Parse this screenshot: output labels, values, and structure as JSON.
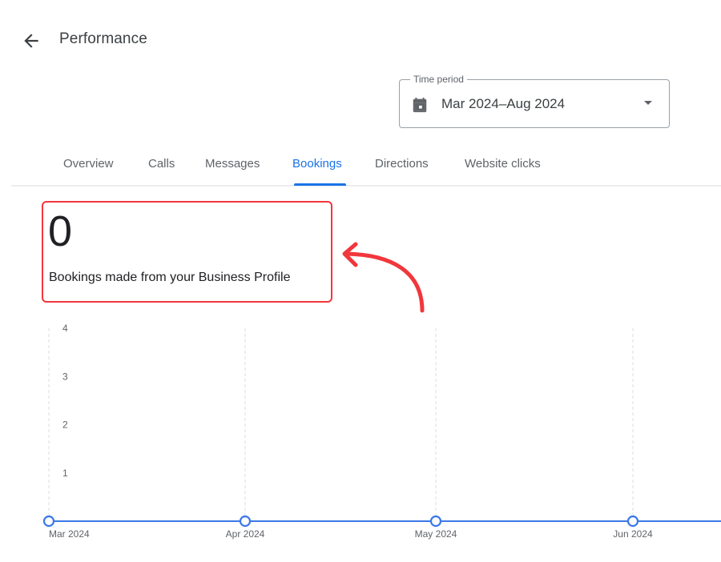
{
  "header": {
    "title": "Performance",
    "back_icon": "arrow-back-icon"
  },
  "time_period": {
    "label": "Time period",
    "value": "Mar 2024–Aug 2024",
    "icon": "calendar-icon",
    "dropdown_icon": "caret-down-icon"
  },
  "tabs": [
    {
      "label": "Overview",
      "active": false
    },
    {
      "label": "Calls",
      "active": false
    },
    {
      "label": "Messages",
      "active": false
    },
    {
      "label": "Bookings",
      "active": true
    },
    {
      "label": "Directions",
      "active": false
    },
    {
      "label": "Website clicks",
      "active": false
    }
  ],
  "summary": {
    "value": "0",
    "description": "Bookings made from your Business Profile"
  },
  "colors": {
    "accent": "#1a73e8",
    "highlight": "#f1373c",
    "series": "#3b78e7"
  },
  "chart_data": {
    "type": "line",
    "title": "",
    "xlabel": "",
    "ylabel": "",
    "x": [
      "Mar 2024",
      "Apr 2024",
      "May 2024",
      "Jun 2024"
    ],
    "series": [
      {
        "name": "Bookings",
        "values": [
          0,
          0,
          0,
          0
        ]
      }
    ],
    "yticks": [
      "1",
      "2",
      "3",
      "4"
    ],
    "ylim": [
      0,
      4
    ],
    "grid": "vertical dashed",
    "legend": "none"
  }
}
